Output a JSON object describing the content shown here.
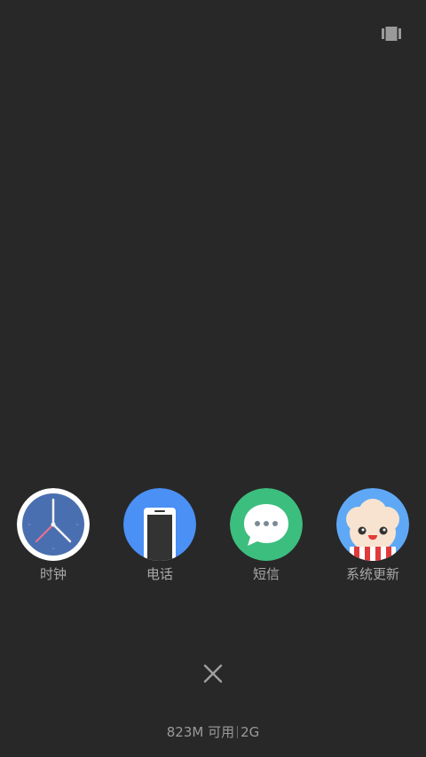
{
  "header": {
    "view_toggle_icon": "multi-window-view-icon"
  },
  "apps": [
    {
      "label": "时钟",
      "icon": "clock-icon",
      "color": "#4A6FB0"
    },
    {
      "label": "电话",
      "icon": "phone-icon",
      "color": "#4A90F5"
    },
    {
      "label": "短信",
      "icon": "message-icon",
      "color": "#3CBE7E"
    },
    {
      "label": "系统更新",
      "icon": "system-update-icon",
      "color": "#5FA8F5"
    }
  ],
  "close": {
    "icon": "close-icon"
  },
  "memory": {
    "available": "823M 可用",
    "total": "2G"
  }
}
